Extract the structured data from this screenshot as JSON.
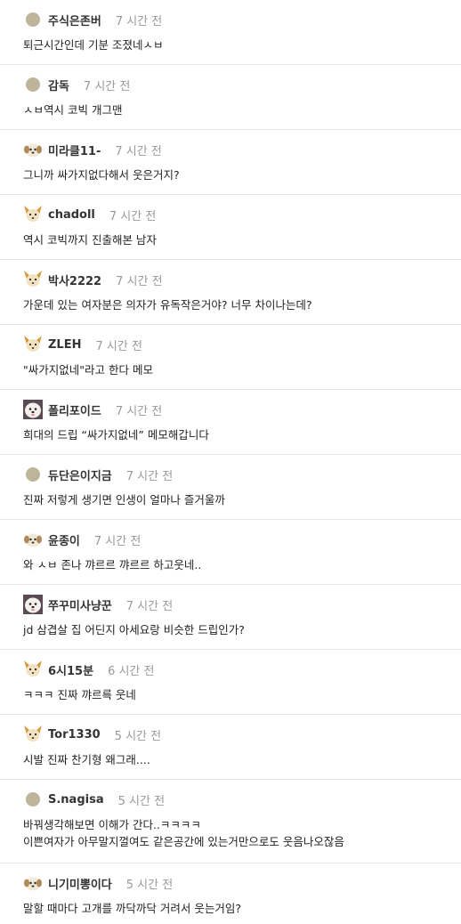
{
  "comments": [
    {
      "nick": "주식은존버",
      "time": "7 시간 전",
      "avatar": "dot",
      "lines": [
        "퇴근시간인데 기분 조졌네ㅅㅂ"
      ]
    },
    {
      "nick": "감독",
      "time": "7 시간 전",
      "avatar": "dot",
      "lines": [
        "ㅅㅂ역시 코빅 개그맨"
      ]
    },
    {
      "nick": "미라클11-",
      "time": "7 시간 전",
      "avatar": "puppy",
      "lines": [
        "그니까 싸가지없다해서 웃은거지?"
      ]
    },
    {
      "nick": "chadoll",
      "time": "7 시간 전",
      "avatar": "fox",
      "lines": [
        "역시 코빅까지 진출해본 남자"
      ]
    },
    {
      "nick": "박사2222",
      "time": "7 시간 전",
      "avatar": "fox",
      "lines": [
        "가운데 있는 여자분은 의자가 유독작은거야? 너무 차이나는데?"
      ]
    },
    {
      "nick": "ZLEH",
      "time": "7 시간 전",
      "avatar": "fox",
      "lines": [
        "\"싸가지없네\"라고 한다 메모"
      ]
    },
    {
      "nick": "폴리포이드",
      "time": "7 시간 전",
      "avatar": "maltese",
      "lines": [
        "희대의 드립 “싸가지없네” 메모해갑니다"
      ]
    },
    {
      "nick": "듀단은이지금",
      "time": "7 시간 전",
      "avatar": "dot",
      "lines": [
        "진짜 저렇게 생기면 인생이 얼마나 즐거울까"
      ]
    },
    {
      "nick": "윤종이",
      "time": "7 시간 전",
      "avatar": "puppy",
      "lines": [
        "와 ㅅㅂ 존나 꺄르르 꺄르르 하고웃네.."
      ]
    },
    {
      "nick": "쭈꾸미사냥꾼",
      "time": "7 시간 전",
      "avatar": "maltese",
      "lines": [
        "jd 삼겹살 집 어딘지 아세요랑 비슷한 드립인가?"
      ]
    },
    {
      "nick": "6시15분",
      "time": "6 시간 전",
      "avatar": "fox",
      "lines": [
        "ㅋㅋㅋ 진짜 꺄르륵 웃네"
      ]
    },
    {
      "nick": "Tor1330",
      "time": "5 시간 전",
      "avatar": "fox",
      "lines": [
        "시발 진짜 찬기형 왜그래...."
      ]
    },
    {
      "nick": "S.nagisa",
      "time": "5 시간 전",
      "avatar": "dot",
      "lines": [
        "바꿔생각해보면 이해가 간다..ㅋㅋㅋㅋ",
        "이쁜여자가 아무말지껄여도 같은공간에 있는거만으로도 웃음나오잖음"
      ]
    },
    {
      "nick": "니기미뽕이다",
      "time": "5 시간 전",
      "avatar": "puppy",
      "lines": [
        "말할 때마다 고개를 까닥까닥 거려서 웃는거임?"
      ]
    }
  ]
}
